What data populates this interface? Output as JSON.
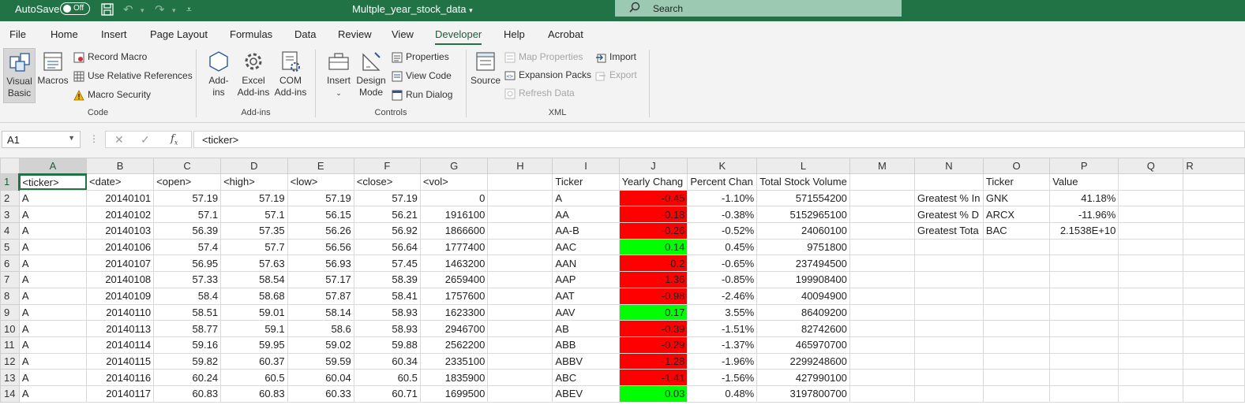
{
  "titlebar": {
    "autosave_label": "AutoSave",
    "autosave_state": "Off",
    "doc_title": "Multple_year_stock_data",
    "search_placeholder": "Search"
  },
  "menu": {
    "tabs": [
      "File",
      "Home",
      "Insert",
      "Page Layout",
      "Formulas",
      "Data",
      "Review",
      "View",
      "Developer",
      "Help",
      "Acrobat"
    ],
    "active_tab": "Developer"
  },
  "ribbon": {
    "code": {
      "group_label": "Code",
      "visual_basic": [
        "Visual",
        "Basic"
      ],
      "macros": "Macros",
      "record_macro": "Record Macro",
      "use_relative_references": "Use Relative References",
      "macro_security": "Macro Security"
    },
    "addins": {
      "group_label": "Add-ins",
      "addins": [
        "Add-",
        "ins"
      ],
      "excel_addins": [
        "Excel",
        "Add-ins"
      ],
      "com_addins": [
        "COM",
        "Add-ins"
      ]
    },
    "controls": {
      "group_label": "Controls",
      "insert": "Insert",
      "design_mode": [
        "Design",
        "Mode"
      ],
      "properties": "Properties",
      "view_code": "View Code",
      "run_dialog": "Run Dialog"
    },
    "xml": {
      "group_label": "XML",
      "source": "Source",
      "map_properties": "Map Properties",
      "expansion_packs": "Expansion Packs",
      "refresh_data": "Refresh Data",
      "import": "Import",
      "export": "Export"
    }
  },
  "formula_bar": {
    "name_box": "A1",
    "formula": "<ticker>"
  },
  "colors": {
    "excel_green": "#217346",
    "negative_fill": "#ff0000",
    "positive_fill": "#00ff00"
  },
  "sheet": {
    "columns": [
      "A",
      "B",
      "C",
      "D",
      "E",
      "F",
      "G",
      "H",
      "I",
      "J",
      "K",
      "L",
      "M",
      "N",
      "O",
      "P",
      "Q",
      "R"
    ],
    "rows": [
      [
        "<ticker>",
        "<date>",
        "<open>",
        "<high>",
        "<low>",
        "<close>",
        "<vol>",
        "",
        "Ticker",
        "Yearly Chang",
        "Percent Chan",
        "Total Stock Volume",
        "",
        "",
        "Ticker",
        "Value",
        "",
        ""
      ],
      [
        "A",
        "20140101",
        "57.19",
        "57.19",
        "57.19",
        "57.19",
        "0",
        "",
        "A",
        "-0.45",
        "-1.10%",
        "571554200",
        "",
        "Greatest % In",
        "GNK",
        "41.18%",
        "",
        ""
      ],
      [
        "A",
        "20140102",
        "57.1",
        "57.1",
        "56.15",
        "56.21",
        "1916100",
        "",
        "AA",
        "-0.18",
        "-0.38%",
        "5152965100",
        "",
        "Greatest % D",
        "ARCX",
        "-11.96%",
        "",
        ""
      ],
      [
        "A",
        "20140103",
        "56.39",
        "57.35",
        "56.26",
        "56.92",
        "1866600",
        "",
        "AA-B",
        "-0.26",
        "-0.52%",
        "24060100",
        "",
        "Greatest Tota",
        "BAC",
        "2.1538E+10",
        "",
        ""
      ],
      [
        "A",
        "20140106",
        "57.4",
        "57.7",
        "56.56",
        "56.64",
        "1777400",
        "",
        "AAC",
        "0.14",
        "0.45%",
        "9751800",
        "",
        "",
        "",
        "",
        "",
        ""
      ],
      [
        "A",
        "20140107",
        "56.95",
        "57.63",
        "56.93",
        "57.45",
        "1463200",
        "",
        "AAN",
        "-0.2",
        "-0.65%",
        "237494500",
        "",
        "",
        "",
        "",
        "",
        ""
      ],
      [
        "A",
        "20140108",
        "57.33",
        "58.54",
        "57.17",
        "58.39",
        "2659400",
        "",
        "AAP",
        "-1.36",
        "-0.85%",
        "199908400",
        "",
        "",
        "",
        "",
        "",
        ""
      ],
      [
        "A",
        "20140109",
        "58.4",
        "58.68",
        "57.87",
        "58.41",
        "1757600",
        "",
        "AAT",
        "-0.98",
        "-2.46%",
        "40094900",
        "",
        "",
        "",
        "",
        "",
        ""
      ],
      [
        "A",
        "20140110",
        "58.51",
        "59.01",
        "58.14",
        "58.93",
        "1623300",
        "",
        "AAV",
        "0.17",
        "3.55%",
        "86409200",
        "",
        "",
        "",
        "",
        "",
        ""
      ],
      [
        "A",
        "20140113",
        "58.77",
        "59.1",
        "58.6",
        "58.93",
        "2946700",
        "",
        "AB",
        "-0.39",
        "-1.51%",
        "82742600",
        "",
        "",
        "",
        "",
        "",
        ""
      ],
      [
        "A",
        "20140114",
        "59.16",
        "59.95",
        "59.02",
        "59.88",
        "2562200",
        "",
        "ABB",
        "-0.29",
        "-1.37%",
        "465970700",
        "",
        "",
        "",
        "",
        "",
        ""
      ],
      [
        "A",
        "20140115",
        "59.82",
        "60.37",
        "59.59",
        "60.34",
        "2335100",
        "",
        "ABBV",
        "-1.28",
        "-1.96%",
        "2299248600",
        "",
        "",
        "",
        "",
        "",
        ""
      ],
      [
        "A",
        "20140116",
        "60.24",
        "60.5",
        "60.04",
        "60.5",
        "1835900",
        "",
        "ABC",
        "-1.41",
        "-1.56%",
        "427990100",
        "",
        "",
        "",
        "",
        "",
        ""
      ],
      [
        "A",
        "20140117",
        "60.83",
        "60.83",
        "60.33",
        "60.71",
        "1699500",
        "",
        "ABEV",
        "0.03",
        "0.48%",
        "3197800700",
        "",
        "",
        "",
        "",
        "",
        ""
      ]
    ]
  }
}
